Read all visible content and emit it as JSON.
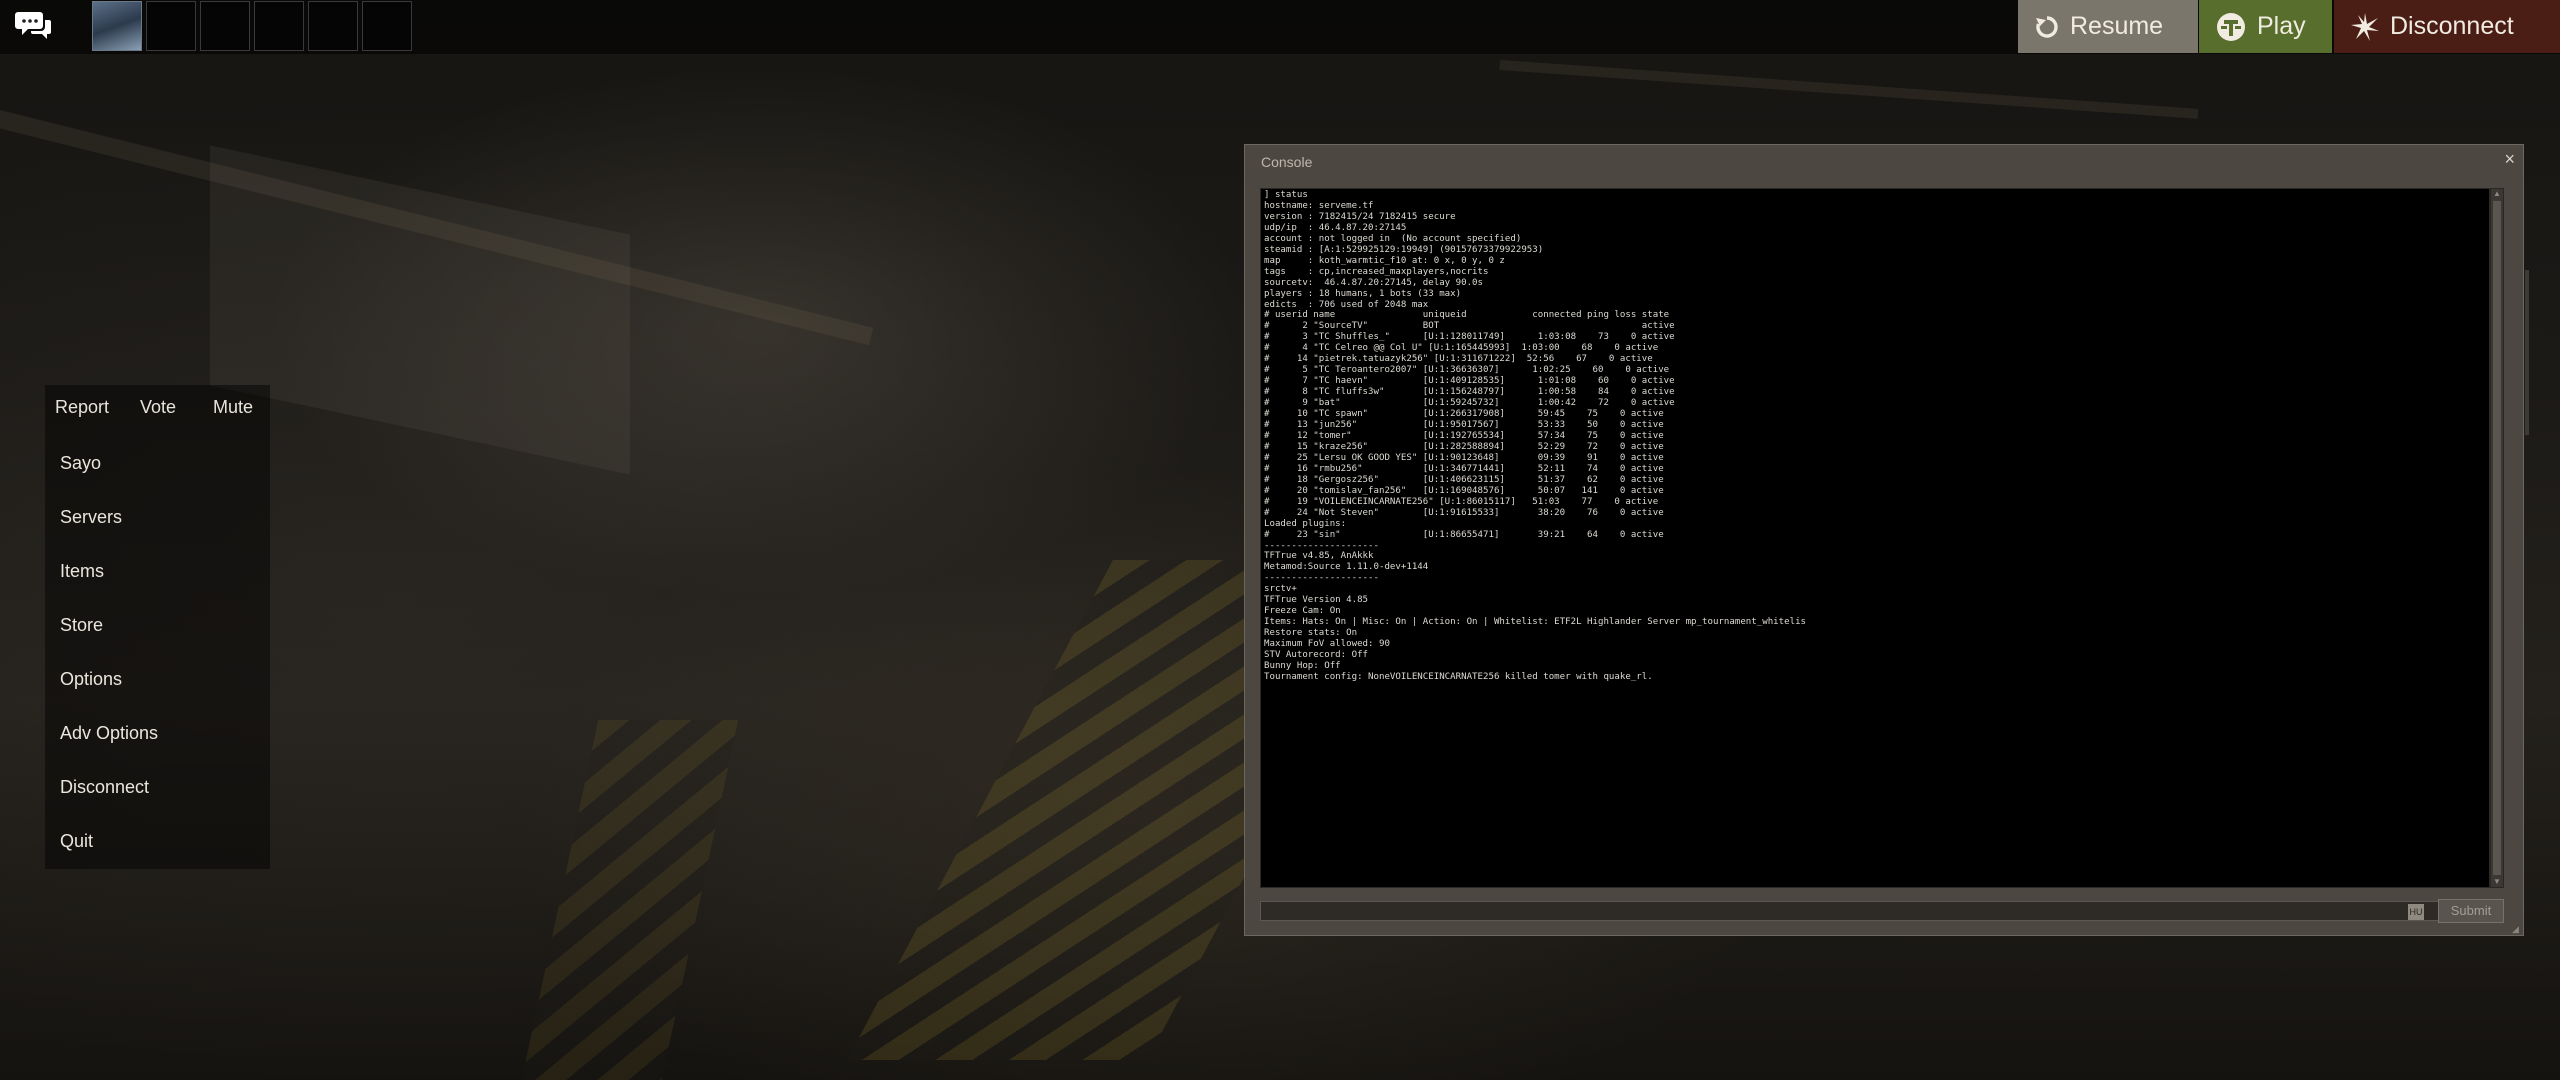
{
  "topbar": {
    "chat_icon": "chat-bubbles-icon",
    "avatar_icon": "player-avatar",
    "slots_count": 5,
    "resume_label": "Resume",
    "resume_icon": "resume-arrow-icon",
    "play_label": "Play",
    "play_icon": "tf2-logo-icon",
    "disconnect_label": "Disconnect",
    "disconnect_icon": "disconnect-burst-icon"
  },
  "menu": {
    "actions": [
      "Report",
      "Vote",
      "Mute"
    ],
    "items": [
      "Sayo",
      "Servers",
      "Items",
      "Store",
      "Options",
      "Adv Options",
      "Disconnect",
      "Quit"
    ]
  },
  "console": {
    "title": "Console",
    "close_glyph": "×",
    "output": [
      "] status",
      "hostname: serveme.tf",
      "version : 7182415/24 7182415 secure",
      "udp/ip  : 46.4.87.20:27145",
      "account : not logged in  (No account specified)",
      "steamid : [A:1:529925129:19949] (90157673379922953)",
      "map     : koth_warmtic_f10 at: 0 x, 0 y, 0 z",
      "tags    : cp,increased_maxplayers,nocrits",
      "sourcetv:  46.4.87.20:27145, delay 90.0s",
      "players : 18 humans, 1 bots (33 max)",
      "edicts  : 706 used of 2048 max",
      "# userid name                uniqueid            connected ping loss state",
      "#      2 \"SourceTV\"          BOT                                     active",
      "#      3 \"TC Shuffles_\"      [U:1:128011749]      1:03:08    73    0 active",
      "#      4 \"TC Celreo @@ Col U\" [U:1:165445993]  1:03:00    68    0 active",
      "#     14 \"pietrek.tatuazyk256\" [U:1:311671222]  52:56    67    0 active",
      "#      5 \"TC Teroantero2007\" [U:1:36636307]      1:02:25    60    0 active",
      "#      7 \"TC haevn\"          [U:1:409128535]      1:01:08    60    0 active",
      "#      8 \"TC fluffs3w\"       [U:1:156248797]      1:00:58    84    0 active",
      "#      9 \"bat\"               [U:1:59245732]       1:00:42    72    0 active",
      "#     10 \"TC spawn\"          [U:1:266317908]      59:45    75    0 active",
      "#     13 \"jun256\"            [U:1:95017567]       53:33    50    0 active",
      "#     12 \"tomer\"             [U:1:192765534]      57:34    75    0 active",
      "#     15 \"kraze256\"          [U:1:282588894]      52:29    72    0 active",
      "#     25 \"Lersu OK GOOD YES\" [U:1:90123648]       09:39    91    0 active",
      "#     16 \"rmbu256\"           [U:1:346771441]      52:11    74    0 active",
      "#     18 \"Gergosz256\"        [U:1:406623115]      51:37    62    0 active",
      "#     20 \"tomislav_fan256\"   [U:1:169048576]      50:07   141    0 active",
      "#     19 \"VOILENCEINCARNATE256\" [U:1:86015117]   51:03    77    0 active",
      "#     24 \"Not Steven\"        [U:1:91615533]       38:20    76    0 active",
      "Loaded plugins:",
      "#     23 \"sin\"               [U:1:86655471]       39:21    64    0 active",
      "---------------------",
      "TFTrue v4.85, AnAkkk",
      "Metamod:Source 1.11.0-dev+1144",
      "---------------------",
      "srctv+",
      "TFTrue Version 4.85",
      "Freeze Cam: On",
      "Items: Hats: On | Misc: On | Action: On | Whitelist: ETF2L Highlander Server mp_tournament_whitelis",
      "Restore stats: On",
      "Maximum FoV allowed: 90",
      "STV Autorecord: Off",
      "Bunny Hop: Off",
      "Tournament config: NoneVOILENCEINCARNATE256 killed tomer with quake_rl."
    ],
    "input_value": "",
    "lang_badge": "HU",
    "submit_label": "Submit",
    "close_icon": "close-icon",
    "resize_icon": "resize-grip-icon"
  }
}
